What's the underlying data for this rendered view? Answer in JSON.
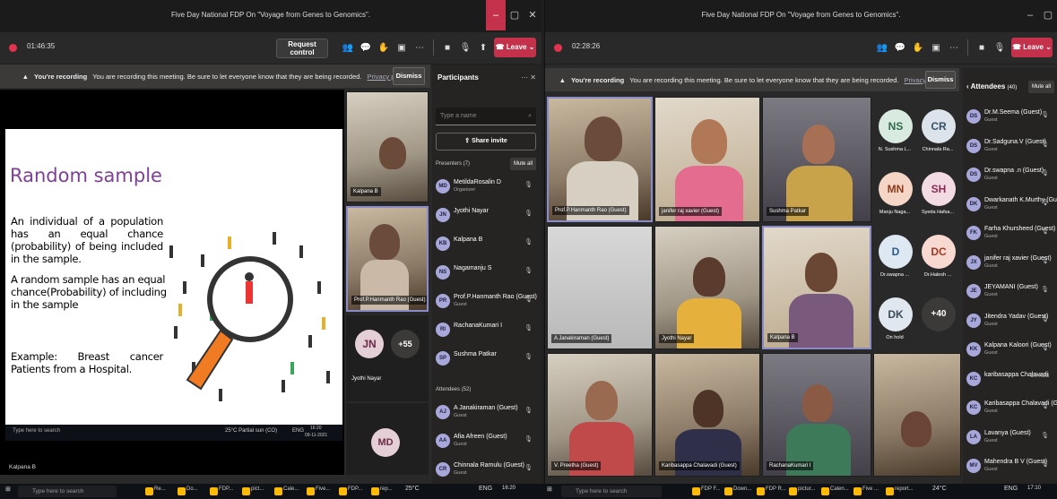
{
  "left": {
    "title": "Five Day National FDP On \"Voyage from Genes to Genomics\".",
    "timer": "01:46:35",
    "request_control": "Request control",
    "leave": "Leave",
    "banner": {
      "bold": "You're recording",
      "text": "You are recording this meeting. Be sure to let everyone know that they are being recorded.",
      "link": "Privacy policy",
      "dismiss": "Dismiss"
    },
    "slide": {
      "title": "Random sample",
      "p1": "An individual of a population has an equal chance (probability) of being included in the sample.",
      "p2": "A random sample has an equal chance(Probability) of including in the sample",
      "p3": "Example: Breast cancer Patients from a Hospital."
    },
    "inner_taskbar": {
      "search": "Type here to search",
      "weather": "25°C Partial sun (CO)",
      "time": "16:20",
      "date": "09-11-2021",
      "lang": "ENG"
    },
    "presenter_label": "Kalpana B",
    "tiles": [
      {
        "name": "Kalpana B"
      },
      {
        "name": "Prof.P.Hanmanth Rao (Guest)"
      }
    ],
    "jn_avatar": {
      "initials": "JN",
      "name": "Jyothi Nayar"
    },
    "overflow": "+55",
    "md_avatar": "MD",
    "participants": {
      "heading": "Participants",
      "search_placeholder": "Type a name",
      "share_invite": "Share invite",
      "presenters_label": "Presenters (7)",
      "mute_all": "Mute all",
      "attendees_label": "Attendees (52)",
      "presenters": [
        {
          "initials": "MD",
          "name": "MetildaRosalin D",
          "sub": "Organizer"
        },
        {
          "initials": "JN",
          "name": "Jyothi Nayar",
          "sub": ""
        },
        {
          "initials": "KB",
          "name": "Kalpana B",
          "sub": ""
        },
        {
          "initials": "NS",
          "name": "Nagamanju S",
          "sub": ""
        },
        {
          "initials": "PR",
          "name": "Prof.P.Hanmanth Rao (Guest)",
          "sub": "Guest"
        },
        {
          "initials": "RI",
          "name": "RachanaKumari I",
          "sub": ""
        },
        {
          "initials": "SP",
          "name": "Sushma Patkar",
          "sub": ""
        }
      ],
      "attendees": [
        {
          "initials": "AJ",
          "name": "A Janakiraman (Guest)",
          "sub": "Guest"
        },
        {
          "initials": "AA",
          "name": "Afia Afreen (Guest)",
          "sub": "Guest"
        },
        {
          "initials": "CR",
          "name": "Chinnala Ramulu (Guest)",
          "sub": "Guest"
        }
      ]
    }
  },
  "right": {
    "title": "Five Day National FDP On \"Voyage from Genes to Genomics\".",
    "timer": "02:28:26",
    "leave": "Leave",
    "banner": {
      "bold": "You're recording",
      "text": "You are recording this meeting. Be sure to let everyone know that they are being recorded.",
      "link": "Privacy policy",
      "dismiss": "Dismiss"
    },
    "tiles": [
      {
        "name": "Prof.P.Hanmanth Rao (Guest)"
      },
      {
        "name": "janifer raj xavier (Guest)"
      },
      {
        "name": "Sushma Patkar"
      },
      {
        "name": "A Janakiraman (Guest)"
      },
      {
        "name": "Jyothi Nayar"
      },
      {
        "name": "Kalpana B"
      },
      {
        "name": "V. Preetha (Guest)"
      },
      {
        "name": "Karibasappa Chalavadi (Guest)"
      },
      {
        "name": "RachanaKumari I"
      },
      {
        "name": ""
      }
    ],
    "avatars": [
      {
        "initials": "NS",
        "name": "N. Sushma L..."
      },
      {
        "initials": "CR",
        "name": "Chinnala Ra..."
      },
      {
        "initials": "MN",
        "name": "Manju Naga..."
      },
      {
        "initials": "SH",
        "name": "Syeda Hafsa..."
      },
      {
        "initials": "D",
        "name": "Dr.swapna ..."
      },
      {
        "initials": "DC",
        "name": "Dr.Halesh ..."
      },
      {
        "initials": "DK",
        "name": "On hold"
      }
    ],
    "overflow": "+40",
    "attendees": {
      "heading": "Attendees",
      "count": "(40)",
      "mute_all": "Mute all",
      "list": [
        {
          "initials": "DS",
          "name": "Dr.M.Seema (Guest)",
          "sub": "Guest",
          "status": ""
        },
        {
          "initials": "DS",
          "name": "Dr.Sadguna.V (Guest)",
          "sub": "Guest",
          "status": ""
        },
        {
          "initials": "DS",
          "name": "Dr.swapna .n (Guest)",
          "sub": "Guest",
          "status": ""
        },
        {
          "initials": "DK",
          "name": "Dwarkanath K.Murthy (Guest)",
          "sub": "Guest",
          "status": ""
        },
        {
          "initials": "FK",
          "name": "Farha Khursheed (Guest)",
          "sub": "Guest",
          "status": ""
        },
        {
          "initials": "JX",
          "name": "janifer raj xavier (Guest)",
          "sub": "Guest",
          "status": ""
        },
        {
          "initials": "JE",
          "name": "JEYAMANI (Guest)",
          "sub": "Guest",
          "status": ""
        },
        {
          "initials": "JY",
          "name": "Jitendra Yadav (Guest)",
          "sub": "Guest",
          "status": ""
        },
        {
          "initials": "KK",
          "name": "Kalpana Kaloori (Guest)",
          "sub": "Guest",
          "status": ""
        },
        {
          "initials": "KC",
          "name": "karibasappa Chalavadi",
          "sub": "",
          "status": "On hold"
        },
        {
          "initials": "KC",
          "name": "Karibasappa Chalavadi (Guest)",
          "sub": "Guest",
          "status": ""
        },
        {
          "initials": "LA",
          "name": "Lavanya (Guest)",
          "sub": "Guest",
          "status": ""
        },
        {
          "initials": "MV",
          "name": "Mahendra B V (Guest)",
          "sub": "Guest",
          "status": ""
        }
      ]
    }
  },
  "taskbar": {
    "search": "Type here to search",
    "apps_left": [
      "Re...",
      "Do...",
      "FDP...",
      "pict...",
      "Cale...",
      "Five...",
      "FDP...",
      "rep..."
    ],
    "tray_left": {
      "weather": "25°C",
      "lang": "ENG",
      "time": "16:20"
    },
    "apps_right": [
      "FDP F...",
      "Down...",
      "FDP R...",
      "pictur...",
      "Calen...",
      "Five ...",
      "report..."
    ],
    "tray_right": {
      "weather": "24°C",
      "lang": "ENG",
      "time": "17:10"
    }
  }
}
